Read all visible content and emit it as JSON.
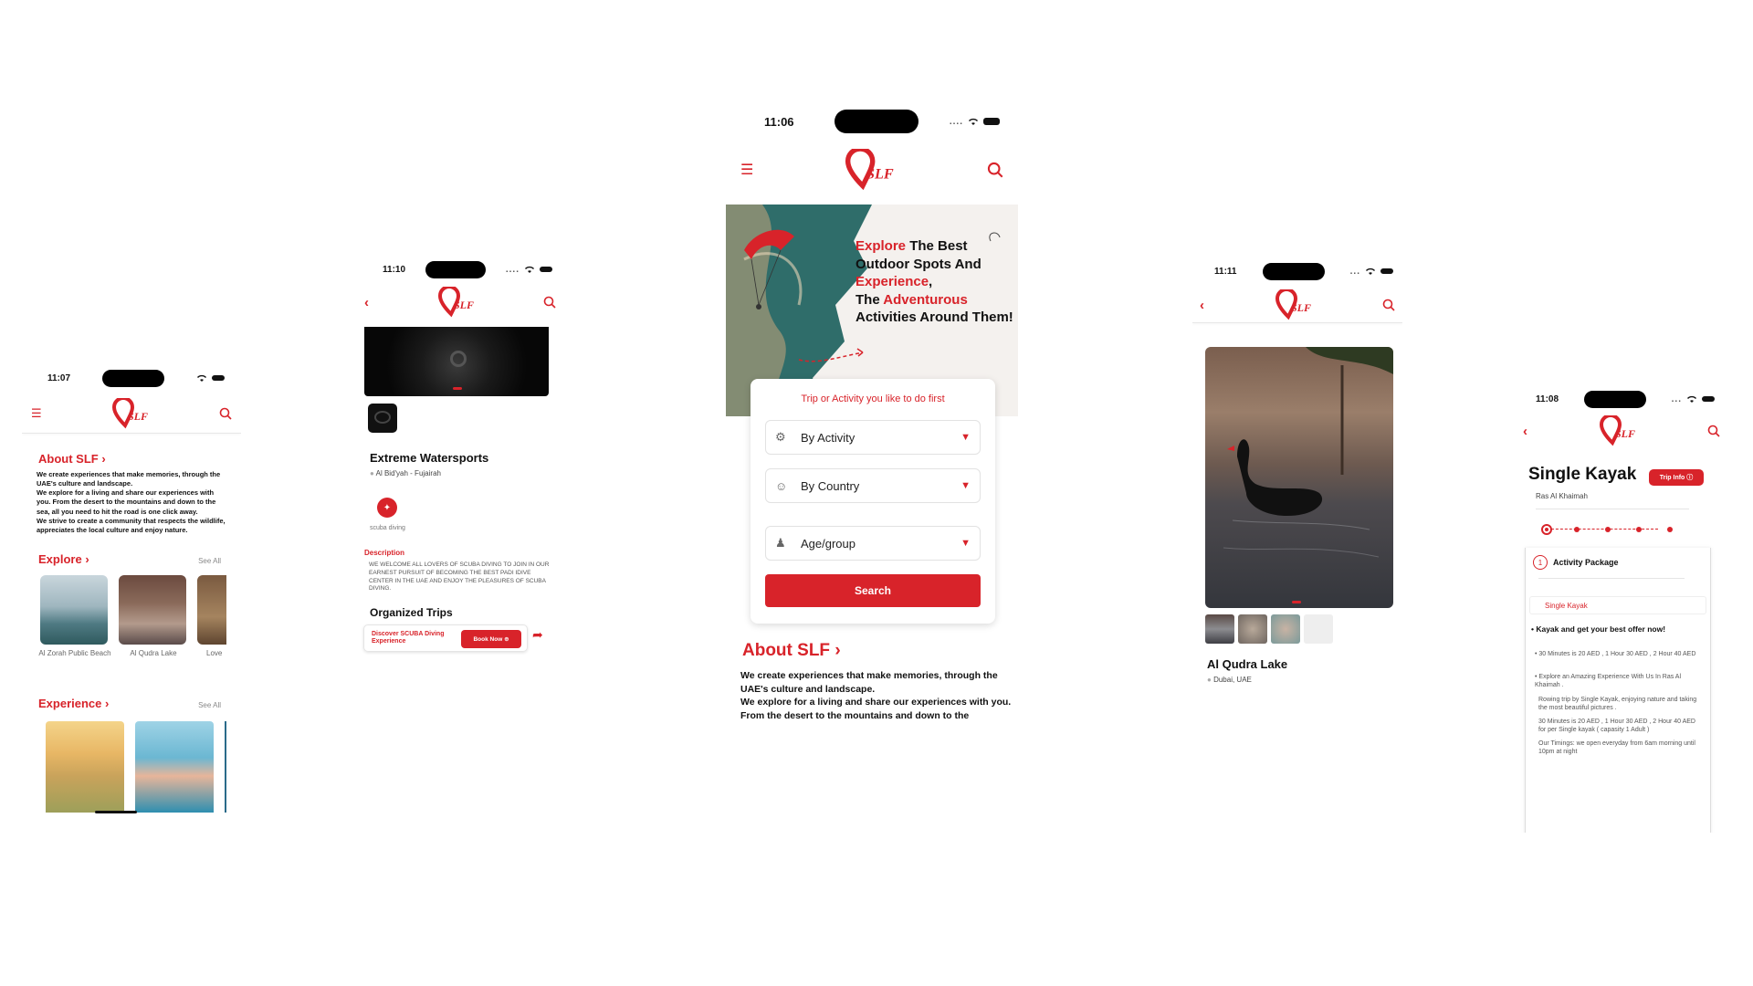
{
  "colors": {
    "accent": "#d8232a",
    "text": "#111111",
    "muted": "#888888"
  },
  "brand": {
    "logo_text": "SLF"
  },
  "screenA": {
    "time": "11:07",
    "about_title": "About SLF",
    "about_text": "We create experiences that make memories, through the UAE's culture and landscape.\nWe explore for a living and share our experiences with you. From the desert to the mountains and down to the sea, all you need to hit the road is one click away.\nWe strive to create a community that respects the wildlife, appreciates the local culture and enjoy nature.",
    "explore_title": "Explore",
    "see_all": "See All",
    "explore_items": [
      {
        "label": "Al Zorah Public Beach"
      },
      {
        "label": "Al Qudra Lake"
      },
      {
        "label": "Love"
      }
    ],
    "experience_title": "Experience"
  },
  "screenB": {
    "time": "11:10",
    "title": "Extreme Watersports",
    "location": "Al Bid'yah - Fujairah",
    "activity_label": "scuba diving",
    "description_title": "Description",
    "description_text": "WE WELCOME ALL LOVERS OF SCUBA DIVING TO JOIN IN OUR EARNEST PURSUIT OF BECOMING THE BEST PADI IDIVE CENTER IN THE UAE AND ENJOY THE PLEASURES OF SCUBA DIVING.",
    "organized_title": "Organized Trips",
    "trip_label": "Discover SCUBA Diving Experience",
    "book_now": "Book Now"
  },
  "screenC": {
    "time": "11:06",
    "hero_line1_red": "Explore",
    "hero_line1_rest": " The Best",
    "hero_line2": "Outdoor Spots And",
    "hero_line3_red": "Experience",
    "hero_line3_rest": ",",
    "hero_line4_pre": "The ",
    "hero_line4_red": "Adventurous",
    "hero_line5": "Activities Around Them!",
    "search_prompt": "Trip or Activity you like to do first",
    "by_activity": "By Activity",
    "by_country": "By Country",
    "age_group": "Age/group",
    "search_button": "Search",
    "about_title": "About SLF",
    "about_text": "We create experiences that make memories, through the UAE's culture and landscape.\nWe explore for a living and share our experiences with you. From the desert to the mountains and down to the"
  },
  "screenD": {
    "time": "11:11",
    "title": "Al Qudra Lake",
    "location": "Dubai, UAE"
  },
  "screenE": {
    "time": "11:08",
    "title": "Single Kayak",
    "trip_info": "Trip Info",
    "location": "Ras Al Khaimah",
    "step_number": "1",
    "step_title": "Activity Package",
    "package_name": "Single Kayak",
    "offer_title": "Kayak and get your best offer now!",
    "bullets": [
      "30 Minutes is 20 AED , 1 Hour 30 AED , 2 Hour 40 AED",
      "Explore an Amazing Experience With Us In Ras Al Khaimah .",
      "Rowing trip by Single Kayak, enjoying nature and taking the most beautiful pictures .",
      "30 Minutes is 20 AED , 1 Hour 30 AED , 2 Hour 40 AED for per Single kayak ( capasity 1 Adult )",
      "Our Timings: we open everyday from 6am morning until 10pm at night"
    ]
  }
}
